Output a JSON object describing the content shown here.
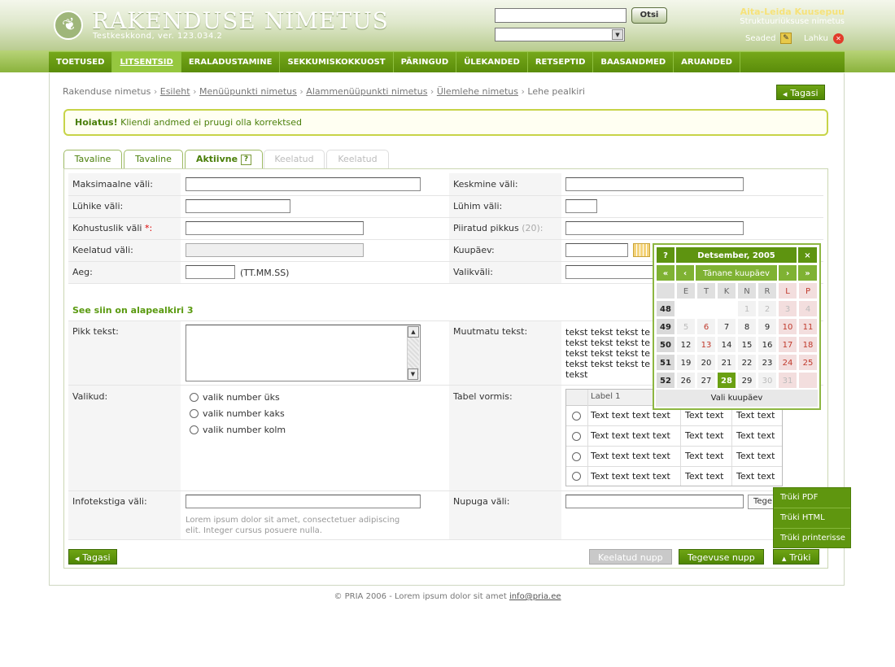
{
  "header": {
    "app_title": "RAKENDUSE NIMETUS",
    "app_version": "Testkeskkond, ver. 123.034.2",
    "search_button": "Otsi",
    "user_name": "Aita-Leida Kuusepuu",
    "unit_name": "Struktuuriüksuse nimetus",
    "settings": "Seaded",
    "logout": "Lahku"
  },
  "nav": [
    "TOETUSED",
    "LITSENTSID",
    "ERALADUSTAMINE",
    "SEKKUMISKOKKUOST",
    "PÄRINGUD",
    "ÜLEKANDED",
    "RETSEPTID",
    "BAASANDMED",
    "ARUANDED"
  ],
  "breadcrumb": {
    "items": [
      "Rakenduse nimetus",
      "Esileht",
      "Menüüpunkti nimetus",
      "Alammenüüpunkti nimetus",
      "Ülemlehe nimetus",
      "Lehe pealkiri"
    ],
    "sep": "›"
  },
  "buttons": {
    "back_top": "Tagasi",
    "back_bottom": "Tagasi",
    "disabled": "Keelatud nupp",
    "action": "Tegevuse nupp",
    "print": "Trüki",
    "row_action": "Tege"
  },
  "warning": {
    "title": "Hoiatus!",
    "text": "Kliendi andmed ei pruugi olla korrektsed"
  },
  "tabs": [
    "Tavaline",
    "Tavaline",
    "Aktiivne",
    "Keelatud",
    "Keelatud"
  ],
  "tab_help": "?",
  "form": {
    "max_field": "Maksimaalne väli:",
    "mid_field": "Keskmine väli:",
    "short_field": "Lühike väli:",
    "shortest_field": "Lühim väli:",
    "required_field": "Kohustuslik väli",
    "required_mark": "*:",
    "limited_length": "Piiratud pikkus",
    "limited_count": "(20):",
    "disabled_field": "Keelatud väli:",
    "date": "Kuupäev:",
    "time": "Aeg:",
    "time_format": "(TT.MM.SS)",
    "select_field": "Valikväli:",
    "subheading": "See siin on alapealkiri 3",
    "long_text": "Pikk tekst:",
    "readonly_text": "Muutmatu tekst:",
    "readonly_lines": [
      "tekst tekst tekst te",
      "tekst tekst tekst te",
      "tekst tekst tekst te",
      "tekst tekst tekst te",
      "tekst"
    ],
    "choices": "Valikud:",
    "choice_options": [
      "valik number üks",
      "valik number kaks",
      "valik number kolm"
    ],
    "table_form": "Tabel vormis:",
    "table_header": "Label 1",
    "table_rows": [
      [
        "Text text text text",
        "Text text",
        "Text text"
      ],
      [
        "Text text text text",
        "Text text",
        "Text text"
      ],
      [
        "Text text text text",
        "Text text",
        "Text text"
      ],
      [
        "Text text text text",
        "Text text",
        "Text text"
      ]
    ],
    "info_field": "Infotekstiga väli:",
    "info_text_1": "Lorem ipsum dolor sit amet, consectetuer adipiscing",
    "info_text_2": "elit. Integer cursus posuere nulla.",
    "button_field": "Nupuga väli:"
  },
  "calendar": {
    "help": "?",
    "title": "Detsember, 2005",
    "close": "×",
    "prev_year": "«",
    "prev_month": "‹",
    "today": "Tänane kuupäev",
    "next_month": "›",
    "next_year": "»",
    "days": [
      "E",
      "T",
      "K",
      "N",
      "R",
      "L",
      "P"
    ],
    "weeks": [
      {
        "wk": "48",
        "d": [
          "",
          "",
          "",
          "1",
          "2",
          "3",
          "4"
        ]
      },
      {
        "wk": "49",
        "d": [
          "5",
          "6",
          "7",
          "8",
          "9",
          "10",
          "11"
        ]
      },
      {
        "wk": "50",
        "d": [
          "12",
          "13",
          "14",
          "15",
          "16",
          "17",
          "18"
        ]
      },
      {
        "wk": "51",
        "d": [
          "19",
          "20",
          "21",
          "22",
          "23",
          "24",
          "25"
        ]
      },
      {
        "wk": "52",
        "d": [
          "26",
          "27",
          "28",
          "29",
          "30",
          "31",
          ""
        ]
      }
    ],
    "footer": "Vali kuupäev"
  },
  "print_menu": [
    "Trüki PDF",
    "Trüki HTML",
    "Trüki printerisse"
  ],
  "footer": {
    "text": "© PRIA 2006 - Lorem ipsum dolor sit amet",
    "email": "info@pria.ee"
  }
}
